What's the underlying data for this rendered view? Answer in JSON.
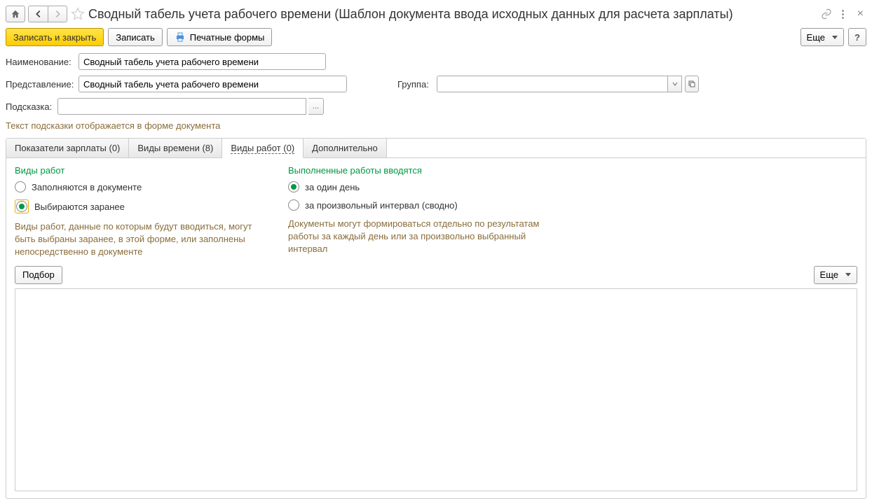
{
  "header": {
    "title": "Сводный табель учета рабочего времени (Шаблон документа ввода исходных данных для расчета зарплаты)"
  },
  "toolbar": {
    "save_close": "Записать и закрыть",
    "save": "Записать",
    "print_forms": "Печатные формы",
    "more": "Еще",
    "help": "?"
  },
  "form": {
    "name_label": "Наименование:",
    "name_value": "Сводный табель учета рабочего времени",
    "presentation_label": "Представление:",
    "presentation_value": "Сводный табель учета рабочего времени",
    "group_label": "Группа:",
    "group_value": "",
    "hint_label": "Подсказка:",
    "hint_value": "",
    "hint_description": "Текст подсказки отображается в форме документа"
  },
  "tabs": {
    "items": [
      {
        "label": "Показатели зарплаты (0)"
      },
      {
        "label": "Виды времени (8)"
      },
      {
        "label": "Виды работ (0)"
      },
      {
        "label": "Дополнительно"
      }
    ],
    "active_index": 2
  },
  "content": {
    "left": {
      "title": "Виды работ",
      "option1": "Заполняются в документе",
      "option2": "Выбираются заранее",
      "description": "Виды работ, данные по которым будут вводиться, могут быть выбраны заранее, в этой форме, или заполнены непосредственно в документе"
    },
    "right": {
      "title": "Выполненные работы вводятся",
      "option1": "за один день",
      "option2": "за произвольный интервал (сводно)",
      "description": "Документы могут формироваться отдельно по результатам работы за каждый день или за произвольно выбранный интервал"
    }
  },
  "actions": {
    "select": "Подбор",
    "more": "Еще"
  }
}
